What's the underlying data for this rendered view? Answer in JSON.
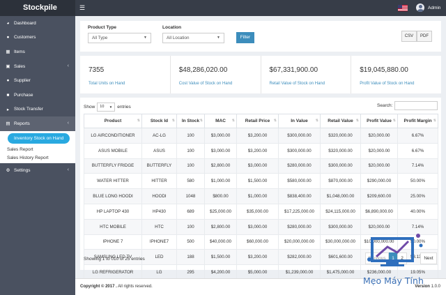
{
  "app": {
    "brand": "Stockpile",
    "user": "Admin"
  },
  "sidebar": {
    "items": [
      {
        "label": "Dashboard",
        "icon": "dashboard-icon"
      },
      {
        "label": "Customers",
        "icon": "users-icon"
      },
      {
        "label": "Items",
        "icon": "items-icon"
      },
      {
        "label": "Sales",
        "icon": "sales-icon",
        "has_children": true
      },
      {
        "label": "Supplier",
        "icon": "supplier-icon"
      },
      {
        "label": "Purchase",
        "icon": "cart-icon"
      },
      {
        "label": "Stock Transfer",
        "icon": "truck-icon"
      },
      {
        "label": "Reports",
        "icon": "reports-icon",
        "has_children": true
      }
    ],
    "reports_submenu": [
      "Inventory Stock on Hand",
      "Sales Report",
      "Sales History Report"
    ],
    "settings": {
      "label": "Settings",
      "icon": "gear-icon"
    }
  },
  "filter": {
    "product_type_label": "Product Type",
    "product_type_value": "All Type",
    "location_label": "Location",
    "location_value": "All Location",
    "filter_button": "Filter",
    "csv_button": "CSV",
    "pdf_button": "PDF"
  },
  "stats": [
    {
      "value": "7355",
      "label": "Total Units on Hand"
    },
    {
      "value": "$48,286,020.00",
      "label": "Cost Value of Stock on Hand"
    },
    {
      "value": "$67,331,900.00",
      "label": "Retail Value of Stock on Hand"
    },
    {
      "value": "$19,045,880.00",
      "label": "Profit Value of Stock on Hand"
    }
  ],
  "table": {
    "show_label": "Show",
    "entries_value": "10",
    "entries_label": "entries",
    "search_label": "Search:",
    "columns": [
      "Product",
      "Stock Id",
      "In Stock",
      "MAC",
      "Retail Price",
      "In Value",
      "Retail Value",
      "Profit Value",
      "Profit Margin"
    ],
    "rows": [
      [
        "LG AIRCONDITIONER",
        "AC-LG",
        "100",
        "$3,000.00",
        "$3,200.00",
        "$300,000.00",
        "$320,000.00",
        "$20,000.00",
        "6.67%"
      ],
      [
        "ASUS MOBILE",
        "ASUS",
        "100",
        "$3,000.00",
        "$3,200.00",
        "$300,000.00",
        "$320,000.00",
        "$20,000.00",
        "6.67%"
      ],
      [
        "BUTTERFLY FRIDGE",
        "BUTTERFLY",
        "100",
        "$2,800.00",
        "$3,000.00",
        "$280,000.00",
        "$300,000.00",
        "$20,000.00",
        "7.14%"
      ],
      [
        "WATER HITTER",
        "HITTER",
        "580",
        "$1,000.00",
        "$1,500.00",
        "$580,000.00",
        "$870,000.00",
        "$290,000.00",
        "50.00%"
      ],
      [
        "BLUE LONG HOODI",
        "HOODI",
        "1048",
        "$800.00",
        "$1,000.00",
        "$838,400.00",
        "$1,048,000.00",
        "$209,600.00",
        "25.00%"
      ],
      [
        "HP LAPTOP 430",
        "HP430",
        "689",
        "$25,000.00",
        "$35,000.00",
        "$17,225,000.00",
        "$24,115,000.00",
        "$6,890,000.00",
        "40.00%"
      ],
      [
        "HTC MOBILE",
        "HTC",
        "100",
        "$2,800.00",
        "$3,000.00",
        "$280,000.00",
        "$300,000.00",
        "$20,000.00",
        "7.14%"
      ],
      [
        "IPHONE 7",
        "IPHONE7",
        "500",
        "$40,000.00",
        "$60,000.00",
        "$20,000,000.00",
        "$30,000,000.00",
        "$10,000,000.00",
        "50.00%"
      ],
      [
        "SAMSUNG LED TV",
        "LED",
        "188",
        "$1,500.00",
        "$3,200.00",
        "$282,000.00",
        "$601,600.00",
        "$319,600.00",
        "53.13%"
      ],
      [
        "LG REFRIGERATOR",
        "LG",
        "295",
        "$4,200.00",
        "$5,000.00",
        "$1,239,000.00",
        "$1,475,000.00",
        "$236,000.00",
        "19.05%"
      ]
    ],
    "showing": "Showing 1 to 010 of 25 entries",
    "pagination": {
      "prev": "Previous",
      "pages": [
        "1",
        "2"
      ],
      "next": "Next"
    }
  },
  "footer": {
    "copyright_bold": "Copyright © 2017 .",
    "copyright_rest": " All rights reserved.",
    "version_label": "Version",
    "version_value": " 1.0.0"
  },
  "watermark": {
    "text": "Mẹo Máy Tính"
  }
}
